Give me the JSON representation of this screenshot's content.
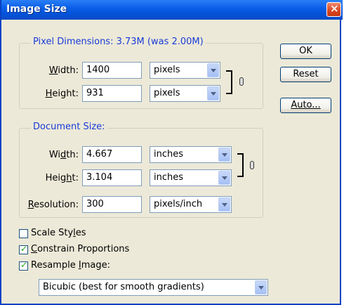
{
  "window": {
    "title": "Image Size",
    "close_label": "×"
  },
  "buttons": {
    "ok": "OK",
    "reset": "Reset",
    "auto": "Auto..."
  },
  "pixel_dimensions": {
    "legend_label": "Pixel Dimensions:",
    "legend_value": "3.73M (was 2.00M)",
    "width": {
      "label_pre": "",
      "label_u": "W",
      "label_post": "idth:",
      "value": "1400",
      "unit": "pixels"
    },
    "height": {
      "label_pre": "",
      "label_u": "H",
      "label_post": "eight:",
      "value": "931",
      "unit": "pixels"
    }
  },
  "document_size": {
    "legend_label": "Document Size:",
    "width": {
      "label_pre": "Wi",
      "label_u": "d",
      "label_post": "th:",
      "value": "4.667",
      "unit": "inches"
    },
    "height": {
      "label_pre": "Heig",
      "label_u": "h",
      "label_post": "t:",
      "value": "3.104",
      "unit": "inches"
    },
    "resolution": {
      "label_pre": "",
      "label_u": "R",
      "label_post": "esolution:",
      "value": "300",
      "unit": "pixels/inch"
    }
  },
  "options": {
    "scale_styles": {
      "pre": "Scale Sty",
      "u": "l",
      "post": "es",
      "checked": false
    },
    "constrain": {
      "pre": "",
      "u": "C",
      "post": "onstrain Proportions",
      "checked": true
    },
    "resample": {
      "pre": "Resample ",
      "u": "I",
      "post": "mage:",
      "checked": true
    },
    "resample_method": "Bicubic (best for smooth gradients)"
  },
  "icons": {
    "check": "✓",
    "link": "chain-link-icon"
  }
}
